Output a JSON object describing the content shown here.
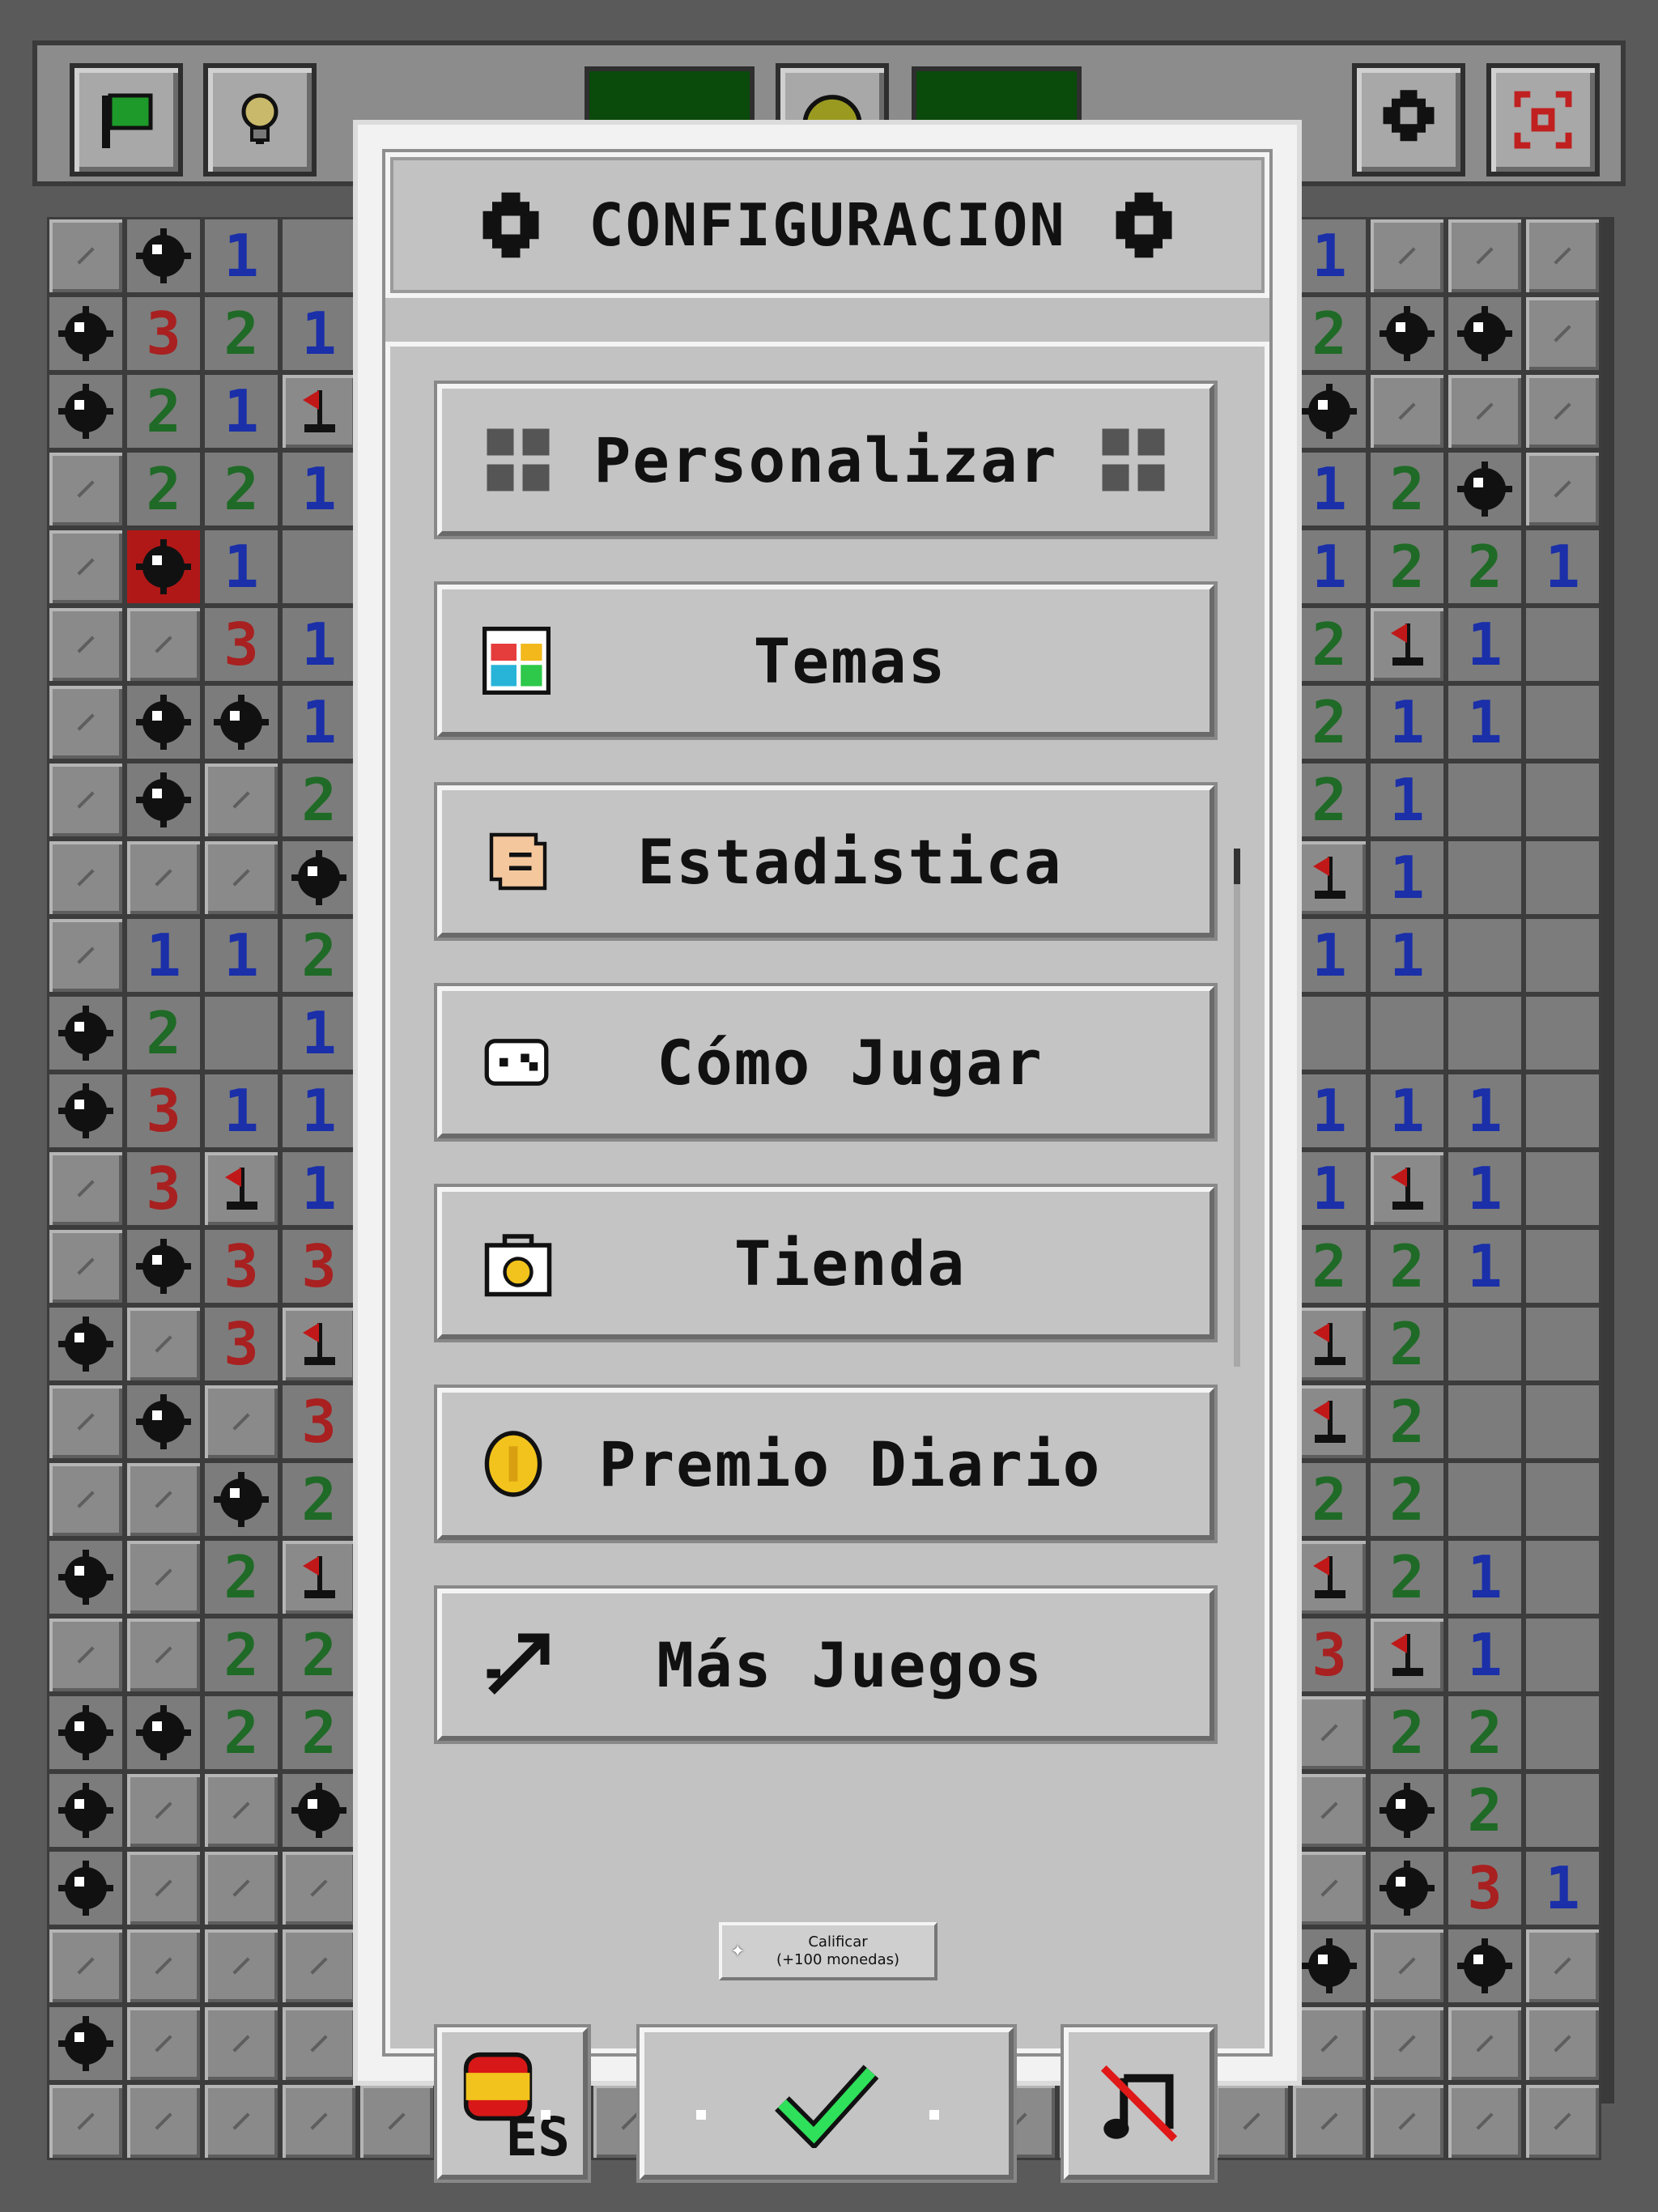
{
  "topbar": {
    "mines_counter": "",
    "timer": "",
    "colors": {
      "counter_bg": "#0a4a0a",
      "counter_fg": "#2cd42c"
    }
  },
  "dialog": {
    "title": "CONFIGURACION",
    "menu": [
      {
        "label": "Personalizar",
        "icon": "grid-icon"
      },
      {
        "label": "Temas",
        "icon": "palette-icon"
      },
      {
        "label": "Estadistica",
        "icon": "scroll-icon"
      },
      {
        "label": "Cómo Jugar",
        "icon": "gamepad-icon"
      },
      {
        "label": "Tienda",
        "icon": "shop-bag-icon"
      },
      {
        "label": "Premio Diario",
        "icon": "coin-icon"
      },
      {
        "label": "Más Juegos",
        "icon": "arrow-icon"
      }
    ],
    "rate": {
      "line1": "Calificar",
      "line2": "(+100 monedas)"
    },
    "language": {
      "code": "ES"
    },
    "confirm": {
      "icon": "checkmark-icon"
    },
    "music": {
      "icon": "music-off-icon"
    }
  }
}
